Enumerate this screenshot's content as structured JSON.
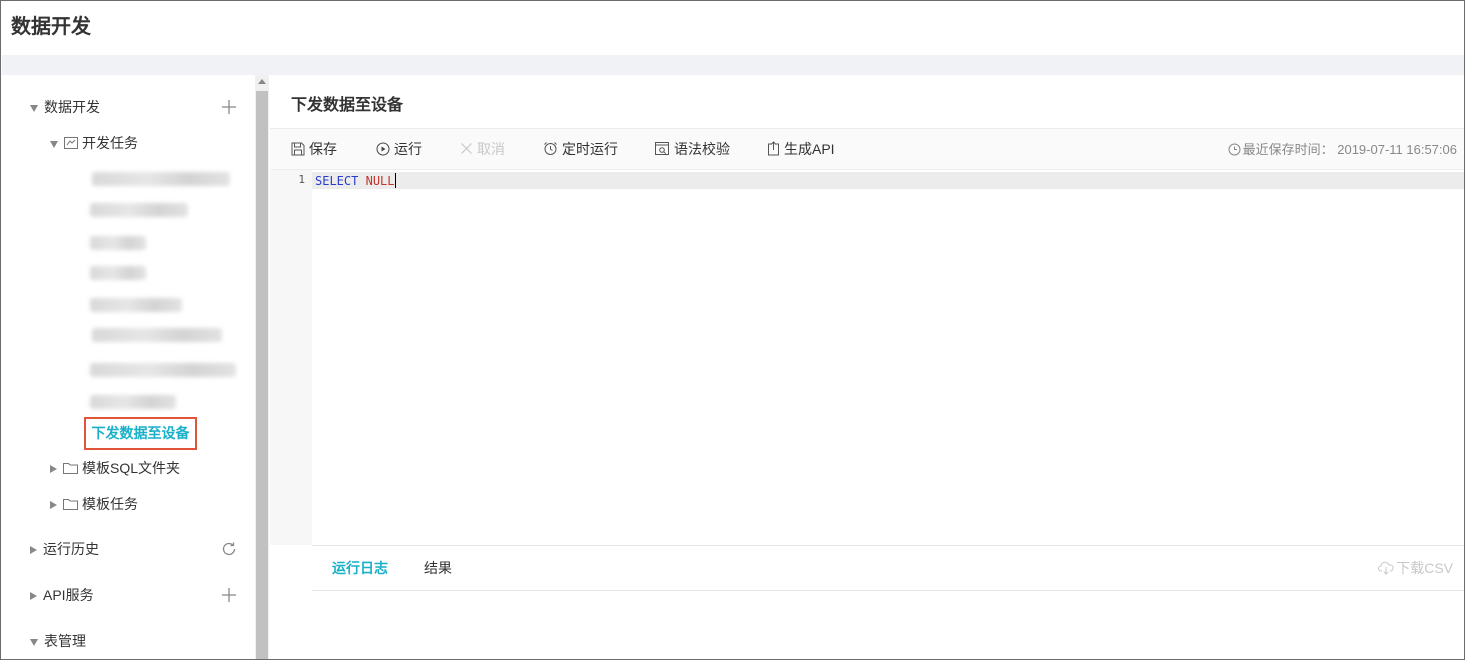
{
  "page": {
    "title": "数据开发"
  },
  "sidebar": {
    "root": {
      "label": "数据开发",
      "expanded": true,
      "action_icon": "plus-icon"
    },
    "dev_tasks": {
      "label": "开发任务",
      "expanded": true
    },
    "active_file": {
      "label": "下发数据至设备"
    },
    "template_sql": {
      "label": "模板SQL文件夹",
      "expanded": false
    },
    "template_tasks": {
      "label": "模板任务",
      "expanded": false
    },
    "run_history": {
      "label": "运行历史",
      "expanded": false,
      "action_icon": "refresh-icon"
    },
    "api_service": {
      "label": "API服务",
      "expanded": false,
      "action_icon": "plus-icon"
    },
    "table_mgmt": {
      "label": "表管理",
      "expanded": true
    }
  },
  "main": {
    "title": "下发数据至设备",
    "toolbar": {
      "save": "保存",
      "run": "运行",
      "cancel": "取消",
      "schedule": "定时运行",
      "syntax_check": "语法校验",
      "generate_api": "生成API"
    },
    "last_saved": "最近保存时间： 2019-07-11 16:57:06",
    "editor": {
      "line_number": "1",
      "code_keyword": "SELECT",
      "code_value": "NULL"
    },
    "bottom": {
      "tabs": [
        "运行日志",
        "结果"
      ],
      "active_tab": 0,
      "download": "下载CSV"
    }
  },
  "colors": {
    "accent": "#1ab0c8",
    "highlight_border": "#e0553a",
    "keyword": "#2a3ec9",
    "null_literal": "#c2362b"
  }
}
